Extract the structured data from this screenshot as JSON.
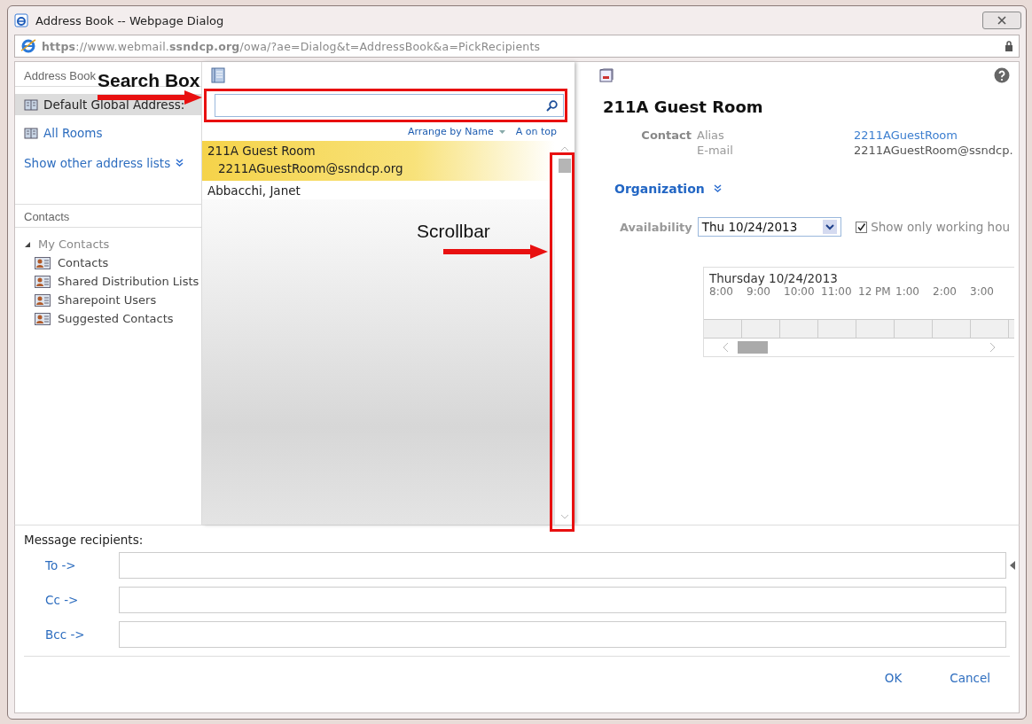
{
  "window": {
    "title": "Address Book -- Webpage Dialog",
    "url": "**https**://www.webmail.**ssndcp.org**/owa/?ae=Dialog&t=AddressBook&a=PickRecipients"
  },
  "sidebar": {
    "address_book": {
      "header": "Address Book",
      "items": [
        {
          "label": "Default Global Address:",
          "selected": true
        },
        {
          "label": "All Rooms",
          "selected": false
        }
      ],
      "show_more": "Show other address lists"
    },
    "contacts": {
      "header": "Contacts",
      "tree": [
        {
          "label": "My Contacts",
          "expanded": true,
          "children": [
            {
              "label": "Contacts"
            },
            {
              "label": "Shared Distribution Lists"
            },
            {
              "label": "Sharepoint Users"
            },
            {
              "label": "Suggested Contacts"
            }
          ]
        }
      ]
    }
  },
  "list": {
    "arrange": "Arrange by Name",
    "order": "A on top",
    "rows": [
      {
        "name": "211A Guest Room",
        "email": "2211AGuestRoom@ssndcp.org",
        "selected": true
      },
      {
        "name": "Abbacchi, Janet",
        "selected": false
      }
    ]
  },
  "detail": {
    "title": "211A Guest Room",
    "group": "Contact",
    "fields": [
      {
        "label": "Alias",
        "value": "2211AGuestRoom",
        "kind": "link"
      },
      {
        "label": "E-mail",
        "value": "2211AGuestRoom@ssndcp.",
        "kind": "text"
      }
    ],
    "section": "Organization",
    "availability": {
      "label": "Availability",
      "date": "Thu 10/24/2013",
      "checkbox": {
        "label": "Show only working hou",
        "checked": true
      }
    },
    "timeline": {
      "day": "Thursday 10/24/2013",
      "hours": [
        "8:00",
        "9:00",
        "10:00",
        "11:00",
        "12 PM",
        "1:00",
        "2:00",
        "3:00"
      ]
    }
  },
  "recipients": {
    "label": "Message recipients:",
    "rows": [
      {
        "label": "To ->"
      },
      {
        "label": "Cc ->"
      },
      {
        "label": "Bcc ->"
      }
    ]
  },
  "buttons": [
    "OK",
    "Cancel"
  ],
  "annotations": [
    {
      "kind": "search",
      "text": "Search Box"
    },
    {
      "kind": "scrollbar",
      "text": "Scrollbar"
    }
  ]
}
